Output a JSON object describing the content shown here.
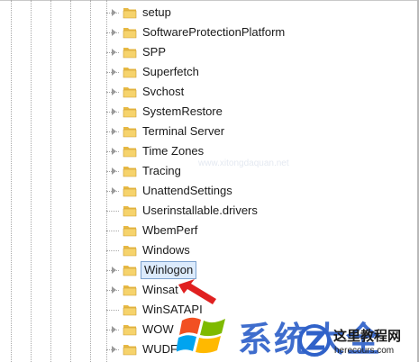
{
  "tree": {
    "items": [
      {
        "label": "setup",
        "expandable": true
      },
      {
        "label": "SoftwareProtectionPlatform",
        "expandable": true
      },
      {
        "label": "SPP",
        "expandable": true
      },
      {
        "label": "Superfetch",
        "expandable": true
      },
      {
        "label": "Svchost",
        "expandable": true
      },
      {
        "label": "SystemRestore",
        "expandable": true
      },
      {
        "label": "Terminal Server",
        "expandable": true
      },
      {
        "label": "Time Zones",
        "expandable": true
      },
      {
        "label": "Tracing",
        "expandable": true
      },
      {
        "label": "UnattendSettings",
        "expandable": true
      },
      {
        "label": "Userinstallable.drivers",
        "expandable": false
      },
      {
        "label": "WbemPerf",
        "expandable": false
      },
      {
        "label": "Windows",
        "expandable": false
      },
      {
        "label": "Winlogon",
        "expandable": true,
        "selected": true
      },
      {
        "label": "Winsat",
        "expandable": true
      },
      {
        "label": "WinSATAPI",
        "expandable": false
      },
      {
        "label": "WOW",
        "expandable": true
      },
      {
        "label": "WUDF",
        "expandable": true
      }
    ]
  },
  "watermark": {
    "logo_text": "系统大全",
    "badge_title": "这里教程网",
    "badge_url": "herecours.com",
    "faint_text": "www.xitongdaquan.net"
  },
  "colors": {
    "folder_body": "#f6d36c",
    "folder_tab": "#e7b944",
    "selection_fill": "#dcebfc",
    "selection_border": "#7da2ce",
    "arrow": "#e02020",
    "logo_blue": "#2f61c9"
  },
  "icons": {
    "folder": "folder-icon",
    "expander": "expand-arrow-icon",
    "pointer": "red-arrow-icon"
  }
}
